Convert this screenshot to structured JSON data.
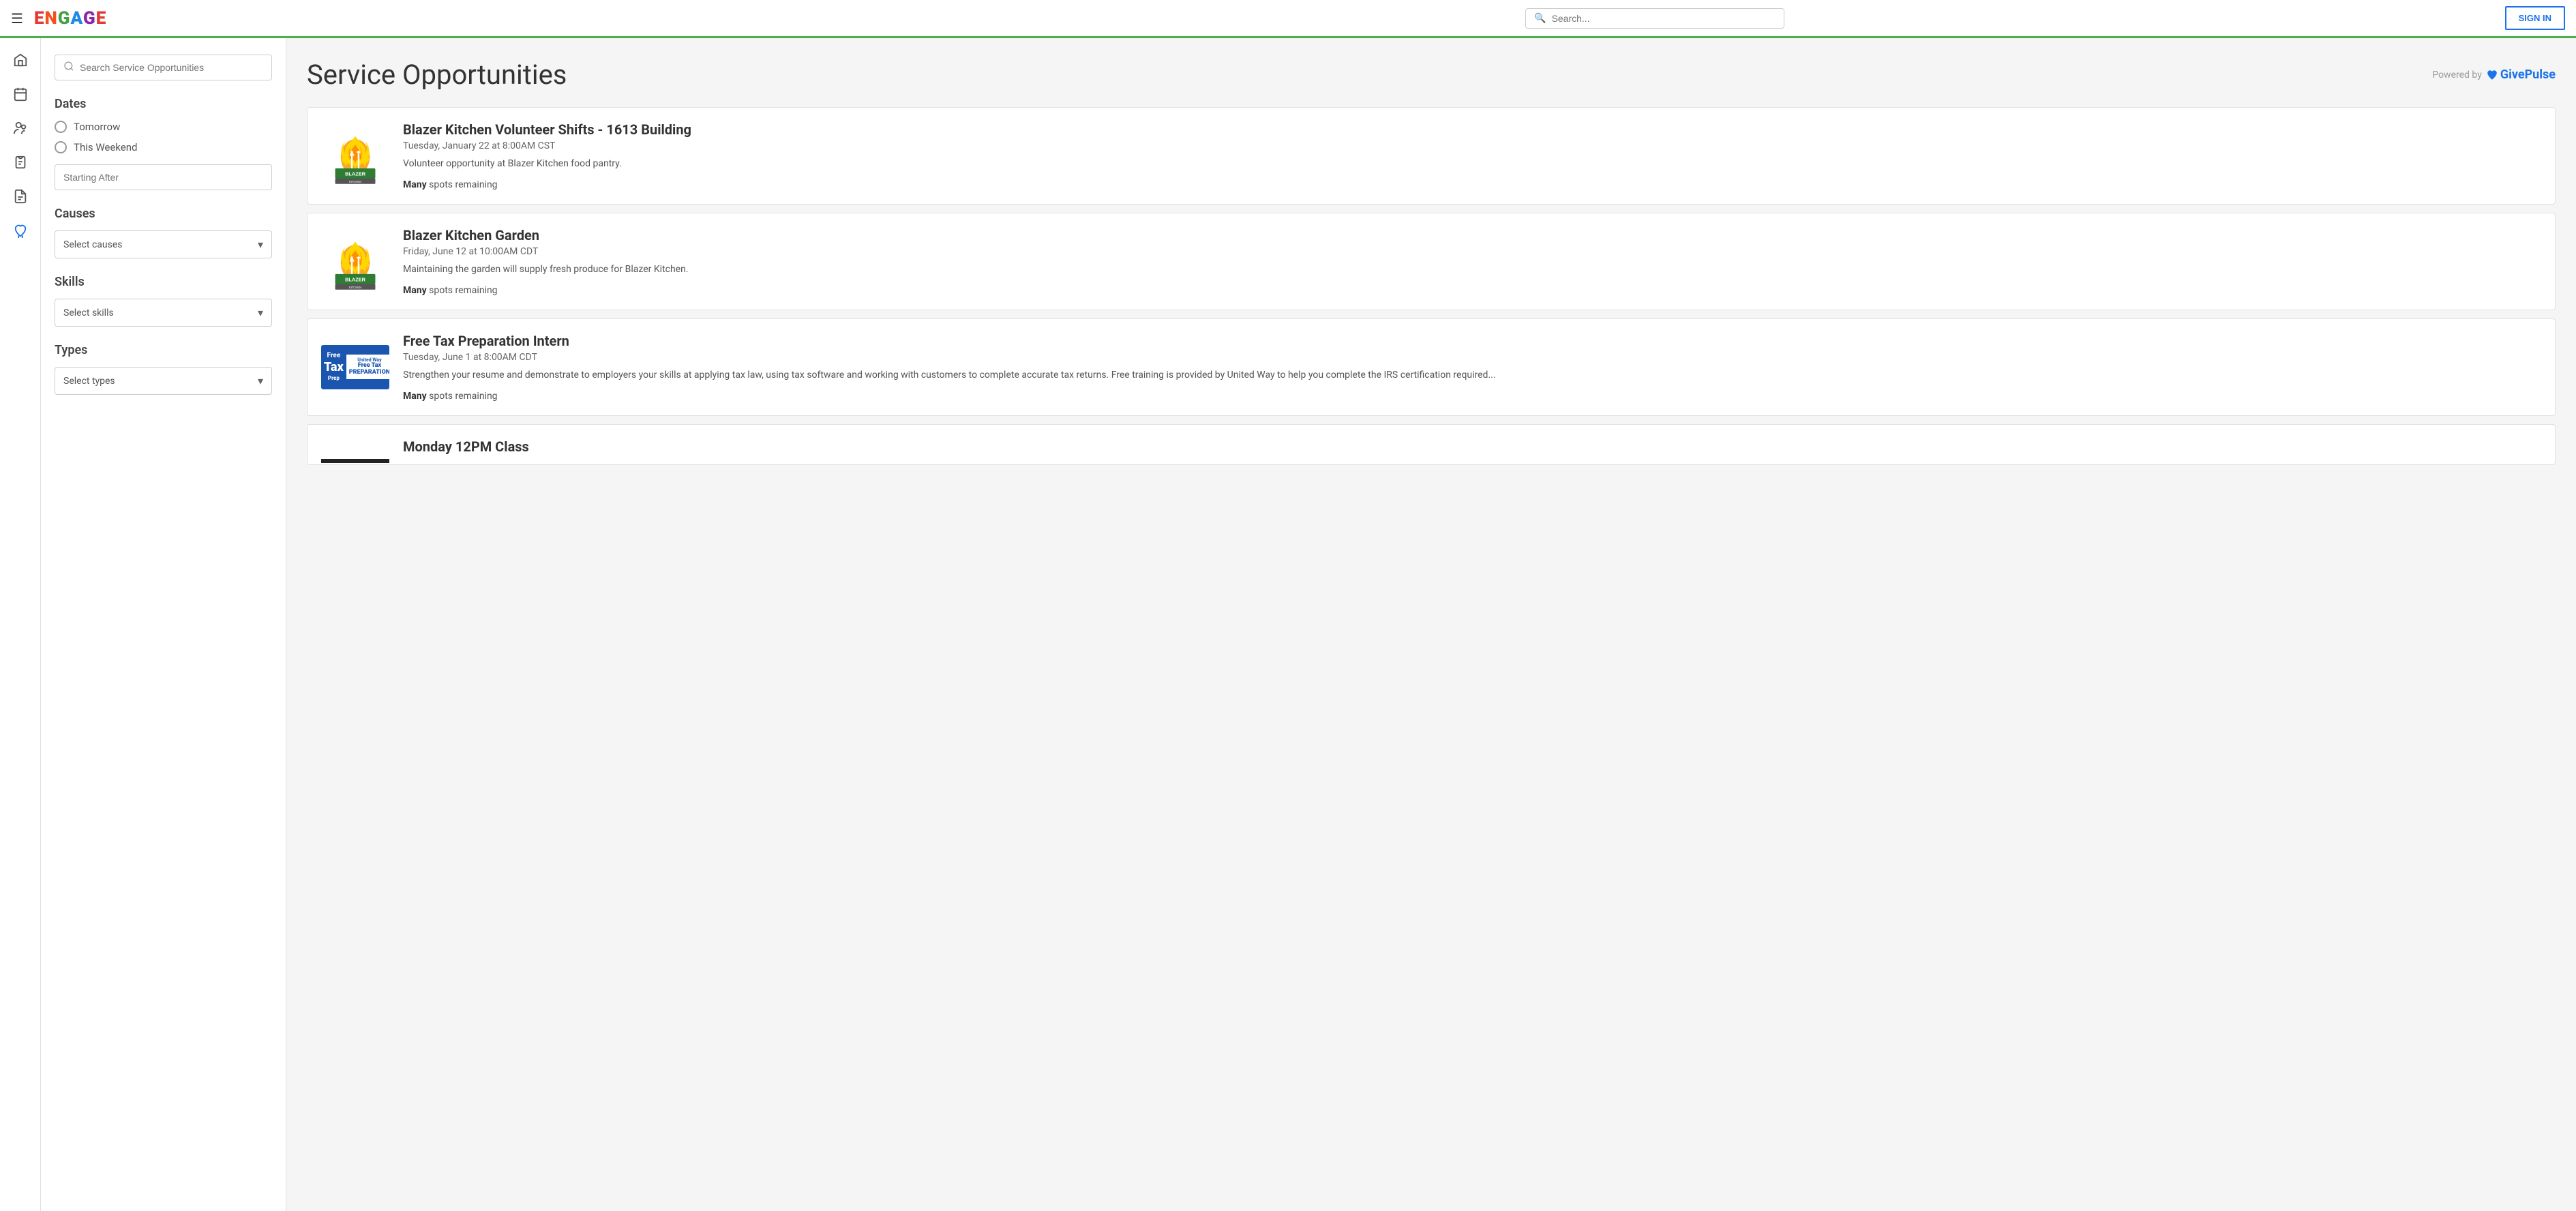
{
  "nav": {
    "logo_letters": [
      "E",
      "N",
      "G",
      "A",
      "G",
      "E"
    ],
    "search_placeholder": "Search...",
    "sign_in_label": "SIGN IN"
  },
  "sidebar": {
    "items": [
      {
        "name": "home-icon",
        "icon": "⌂",
        "active": false
      },
      {
        "name": "calendar-icon",
        "icon": "📅",
        "active": false
      },
      {
        "name": "people-icon",
        "icon": "👥",
        "active": false
      },
      {
        "name": "clipboard-icon",
        "icon": "📋",
        "active": false
      },
      {
        "name": "document-icon",
        "icon": "📄",
        "active": false
      },
      {
        "name": "heart-hands-icon",
        "icon": "🤲",
        "active": true
      }
    ]
  },
  "page": {
    "title": "Service Opportunities",
    "powered_by": "Powered by",
    "givepulse": "GivePulse"
  },
  "filters": {
    "search_placeholder": "Search Service Opportunities",
    "dates_label": "Dates",
    "tomorrow_label": "Tomorrow",
    "this_weekend_label": "This Weekend",
    "starting_after_placeholder": "Starting After",
    "causes_label": "Causes",
    "causes_placeholder": "Select causes",
    "skills_label": "Skills",
    "skills_placeholder": "Select skills",
    "types_label": "Types",
    "types_placeholder": "Select types"
  },
  "opportunities": [
    {
      "id": 1,
      "title": "Blazer Kitchen Volunteer Shifts - 1613 Building",
      "date": "Tuesday, January 22 at 8:00AM CST",
      "description": "Volunteer opportunity at Blazer Kitchen food pantry.",
      "spots_label": "Many",
      "spots_suffix": " spots remaining",
      "logo_type": "blazer"
    },
    {
      "id": 2,
      "title": "Blazer Kitchen Garden",
      "date": "Friday, June 12 at 10:00AM CDT",
      "description": "Maintaining the garden will supply fresh produce for Blazer Kitchen.",
      "spots_label": "Many",
      "spots_suffix": " spots remaining",
      "logo_type": "blazer"
    },
    {
      "id": 3,
      "title": "Free Tax Preparation Intern",
      "date": "Tuesday, June 1 at 8:00AM CDT",
      "description": "Strengthen your resume and demonstrate to employers your skills at applying tax law, using tax software and working with customers to complete accurate tax returns.  Free training is provided by United Way to help you complete the IRS certification required...",
      "spots_label": "Many",
      "spots_suffix": " spots remaining",
      "logo_type": "tax"
    },
    {
      "id": 4,
      "title": "Monday 12PM Class",
      "date": "",
      "description": "",
      "spots_label": "",
      "spots_suffix": "",
      "logo_type": "bottom"
    }
  ]
}
